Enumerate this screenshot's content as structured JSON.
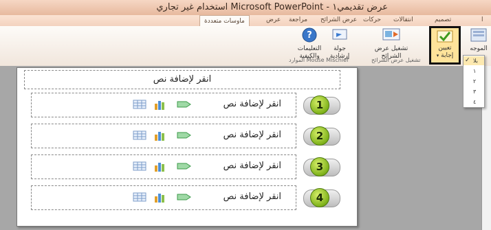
{
  "window": {
    "title": "عرض تقديمي١ - Microsoft PowerPoint استخدام غير تجاري"
  },
  "tabs": {
    "home_partial": "ا",
    "design_partial": "تصميم",
    "transitions_partial": "انتقالات",
    "animations": "حركات",
    "slideshow": "عرض الشرائح",
    "review": "مراجعة",
    "view": "عرض",
    "multimedia": "ماوسات متعددة"
  },
  "ribbon": {
    "buttons": {
      "presenter": "الموجه",
      "set_time": "تعيين",
      "response": "إجابة",
      "play_slideshow": "تشغيل عرض\nالشرائح",
      "guided_tour": "جولة\nإرشادية",
      "instructions": "التعليمات\nوالكيفية"
    },
    "group_labels": {
      "left": "ا",
      "play": "تشغيل عرض الشرائح",
      "resources": "Mouse Mischief الموارد"
    }
  },
  "dropdown": {
    "items": [
      {
        "label": "بلا",
        "checked": true
      },
      {
        "label": "١",
        "checked": false
      },
      {
        "label": "٢",
        "checked": false
      },
      {
        "label": "٣",
        "checked": false
      },
      {
        "label": "٤",
        "checked": false
      }
    ]
  },
  "slide": {
    "title_placeholder": "انقر لإضافة نص",
    "rows": [
      {
        "number": "1",
        "placeholder": "انقر لإضافة نص"
      },
      {
        "number": "2",
        "placeholder": "انقر لإضافة نص"
      },
      {
        "number": "3",
        "placeholder": "انقر لإضافة نص"
      },
      {
        "number": "4",
        "placeholder": "انقر لإضافة نص"
      }
    ]
  },
  "colors": {
    "accent_green": "#7fb21b",
    "title_bg": "#e7b99e",
    "workspace": "#a7a7a7"
  }
}
